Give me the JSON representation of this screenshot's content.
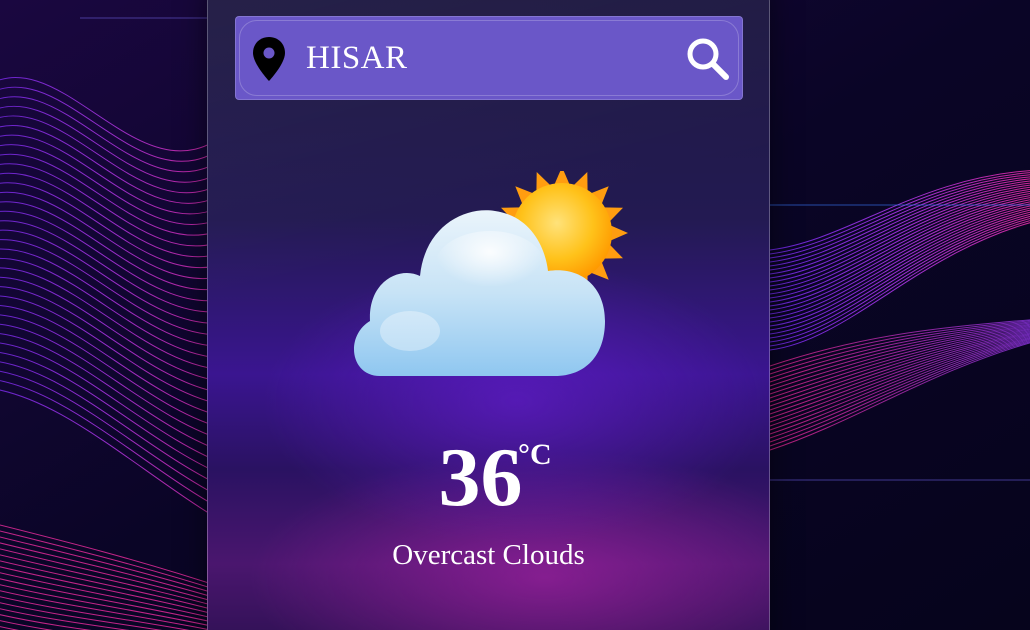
{
  "search": {
    "city_value": "HISAR",
    "location_icon": "map-pin-icon",
    "search_icon": "magnifier-icon"
  },
  "weather": {
    "icon": "partly-cloudy-sun-icon",
    "temperature": "36",
    "unit": "°C",
    "condition": "Overcast Clouds"
  },
  "colors": {
    "search_bar": "#6a57c8",
    "text": "#ffffff",
    "accent_magenta": "#e020c0",
    "accent_purple": "#6a1fe0"
  }
}
